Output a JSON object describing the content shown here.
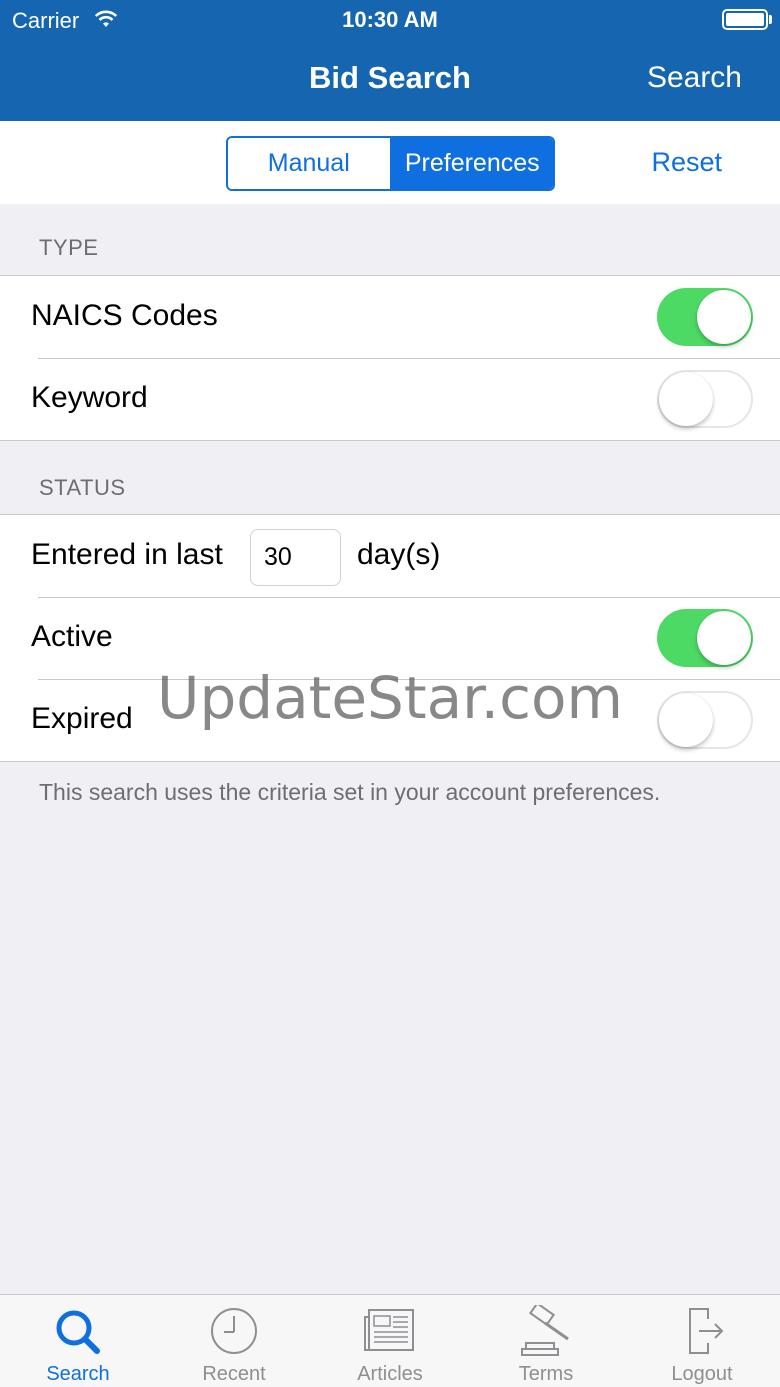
{
  "status_bar": {
    "carrier": "Carrier",
    "time": "10:30 AM"
  },
  "nav": {
    "title": "Bid Search",
    "search_label": "Search"
  },
  "segmented": {
    "manual": "Manual",
    "preferences": "Preferences",
    "selected": "Preferences"
  },
  "reset_label": "Reset",
  "type_section": {
    "header": "TYPE",
    "rows": [
      {
        "label": "NAICS Codes",
        "enabled": true
      },
      {
        "label": "Keyword",
        "enabled": false
      }
    ]
  },
  "status_section": {
    "header": "STATUS",
    "entered_prefix": "Entered in last",
    "days_value": "30",
    "days_suffix": "day(s)",
    "rows": [
      {
        "label": "Active",
        "enabled": true
      },
      {
        "label": "Expired",
        "enabled": false
      }
    ]
  },
  "footnote": "This search uses the criteria set in your account preferences.",
  "watermark": "UpdateStar.com",
  "tabs": [
    {
      "label": "Search",
      "icon": "search-icon",
      "active": true
    },
    {
      "label": "Recent",
      "icon": "clock-icon",
      "active": false
    },
    {
      "label": "Articles",
      "icon": "newspaper-icon",
      "active": false
    },
    {
      "label": "Terms",
      "icon": "gavel-icon",
      "active": false
    },
    {
      "label": "Logout",
      "icon": "logout-icon",
      "active": false
    }
  ],
  "colors": {
    "header": "#1565b0",
    "accent": "#0f6fe0",
    "toggle_on": "#4cd964",
    "background": "#efeff4"
  }
}
